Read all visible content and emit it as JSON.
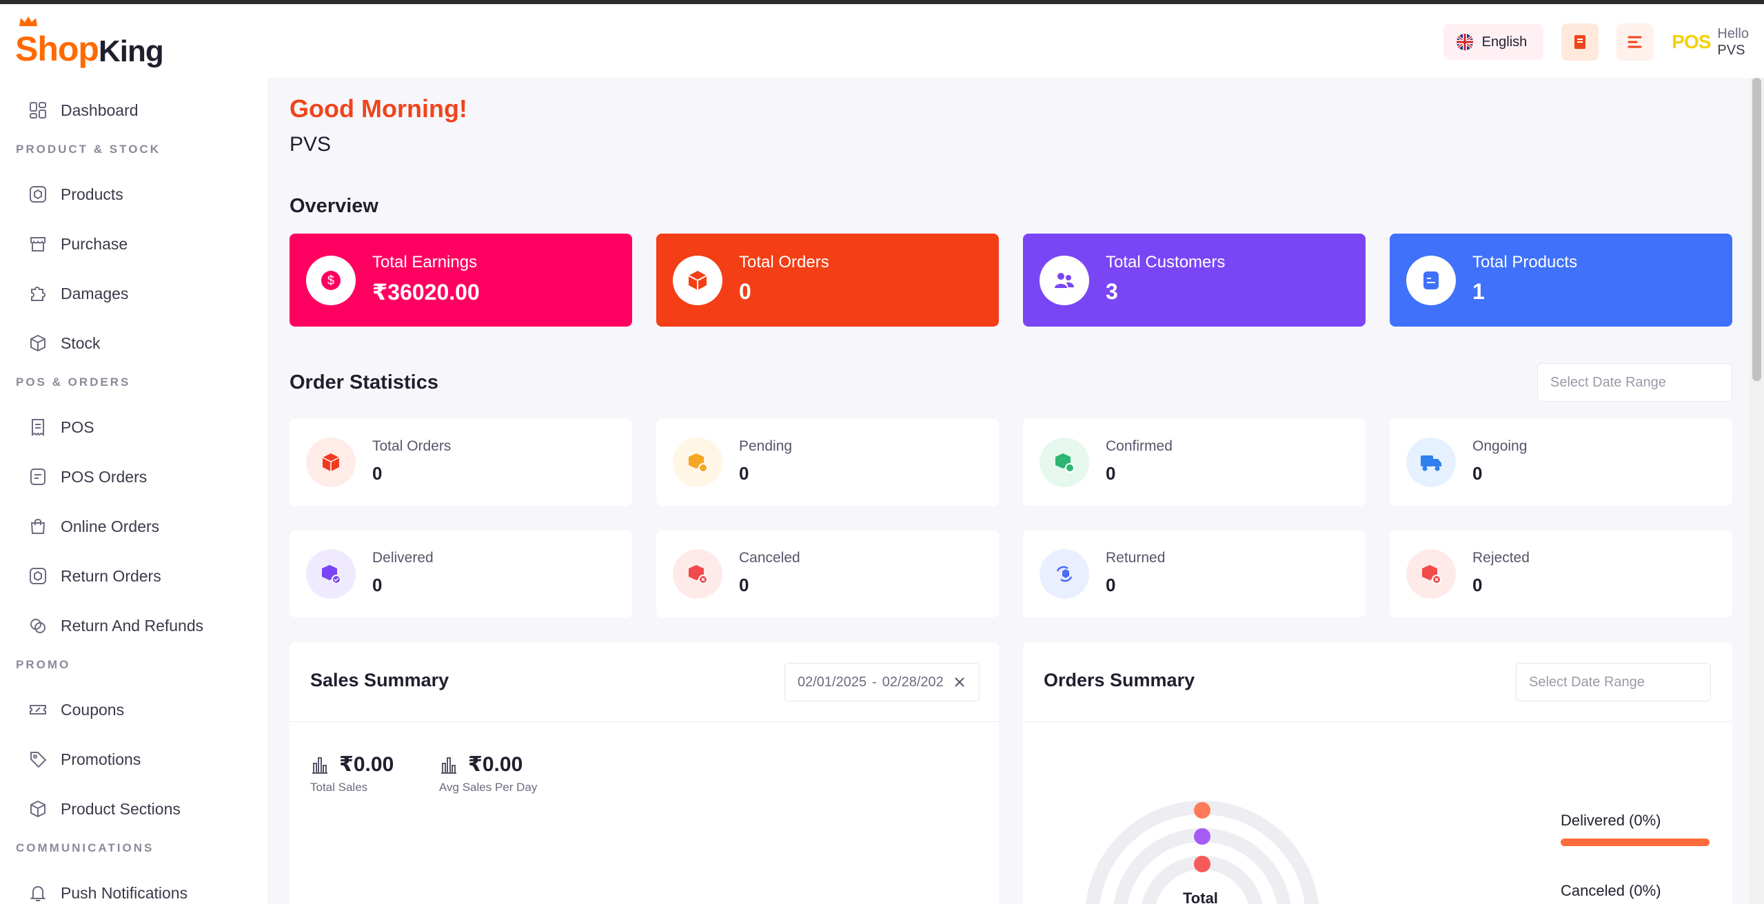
{
  "brand": {
    "part1": "Shop",
    "part2": "King"
  },
  "header": {
    "language": "English",
    "user_logo": "POS",
    "hello": "Hello",
    "user_name": "PVS"
  },
  "sidebar": {
    "dashboard": "Dashboard",
    "sections": {
      "product_stock": "PRODUCT & STOCK",
      "pos_orders": "POS & ORDERS",
      "promo": "PROMO",
      "communications": "COMMUNICATIONS"
    },
    "items": {
      "products": "Products",
      "purchase": "Purchase",
      "damages": "Damages",
      "stock": "Stock",
      "pos": "POS",
      "pos_orders": "POS Orders",
      "online_orders": "Online Orders",
      "return_orders": "Return Orders",
      "return_refunds": "Return And Refunds",
      "coupons": "Coupons",
      "promotions": "Promotions",
      "product_sections": "Product Sections",
      "push_notifications": "Push Notifications"
    }
  },
  "main": {
    "greeting": "Good Morning!",
    "name": "PVS",
    "overview_title": "Overview",
    "overview": {
      "earnings": {
        "label": "Total Earnings",
        "value": "₹36020.00",
        "color": "#ff0060"
      },
      "orders": {
        "label": "Total Orders",
        "value": "0",
        "color": "#f33e16"
      },
      "customers": {
        "label": "Total Customers",
        "value": "3",
        "color": "#7a46f5"
      },
      "products": {
        "label": "Total Products",
        "value": "1",
        "color": "#3f71fb"
      }
    },
    "order_stats_title": "Order Statistics",
    "date_range_placeholder": "Select Date Range",
    "stats": {
      "total_orders": {
        "label": "Total Orders",
        "value": "0"
      },
      "pending": {
        "label": "Pending",
        "value": "0"
      },
      "confirmed": {
        "label": "Confirmed",
        "value": "0"
      },
      "ongoing": {
        "label": "Ongoing",
        "value": "0"
      },
      "delivered": {
        "label": "Delivered",
        "value": "0"
      },
      "canceled": {
        "label": "Canceled",
        "value": "0"
      },
      "returned": {
        "label": "Returned",
        "value": "0"
      },
      "rejected": {
        "label": "Rejected",
        "value": "0"
      }
    },
    "sales_summary": {
      "title": "Sales Summary",
      "date_from": "02/01/2025",
      "date_sep": "-",
      "date_to": "02/28/202",
      "total_sales": {
        "value": "₹0.00",
        "caption": "Total Sales"
      },
      "avg_sales": {
        "value": "₹0.00",
        "caption": "Avg Sales Per Day"
      }
    },
    "orders_summary": {
      "title": "Orders Summary",
      "date_placeholder": "Select Date Range",
      "center_label": "Total",
      "legend_delivered": "Delivered (0%)",
      "legend_canceled": "Canceled (0%)"
    }
  }
}
